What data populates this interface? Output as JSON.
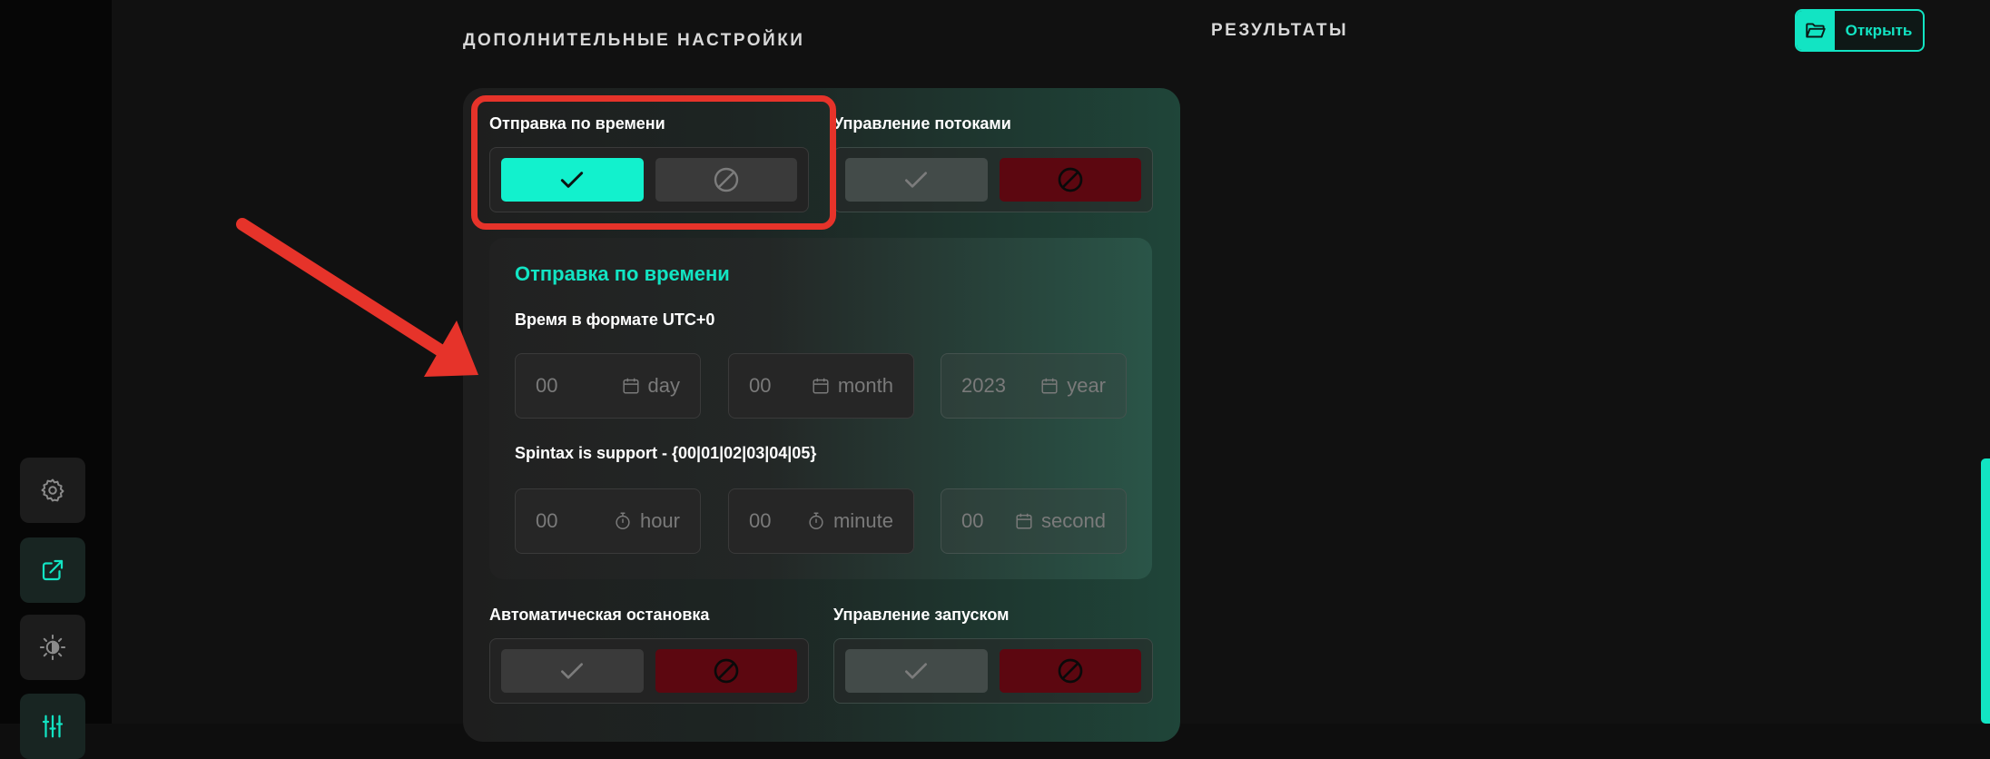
{
  "header": {
    "additional_settings": "ДОПОЛНИТЕЛЬНЫЕ НАСТРОЙКИ",
    "results": "РЕЗУЛЬТАТЫ",
    "open_button": "Открыть"
  },
  "settings": {
    "scheduled_send": {
      "label": "Отправка по времени",
      "state": "on"
    },
    "thread_control": {
      "label": "Управление потоками",
      "state": "off"
    },
    "auto_stop": {
      "label": "Автоматическая остановка",
      "state": "off"
    },
    "launch_control": {
      "label": "Управление запуском",
      "state": "off"
    }
  },
  "schedule": {
    "title": "Отправка по времени",
    "time_label": "Время в формате UTC+0",
    "spintax_label": "Spintax is support - {00|01|02|03|04|05}",
    "date_fields": [
      {
        "value": "00",
        "unit": "day"
      },
      {
        "value": "00",
        "unit": "month"
      },
      {
        "value": "2023",
        "unit": "year"
      }
    ],
    "time_fields": [
      {
        "value": "00",
        "unit": "hour"
      },
      {
        "value": "00",
        "unit": "minute"
      },
      {
        "value": "00",
        "unit": "second"
      }
    ]
  },
  "colors": {
    "accent": "#12e4c3",
    "deny": "#5c0710",
    "annotation": "#e6332a"
  },
  "icons": {
    "sidebar": [
      "gear-icon",
      "external-link-icon",
      "brightness-icon",
      "sliders-icon"
    ],
    "open_button": "folder-open-icon",
    "toggle_on": "check-icon",
    "toggle_off": "forbidden-icon"
  }
}
